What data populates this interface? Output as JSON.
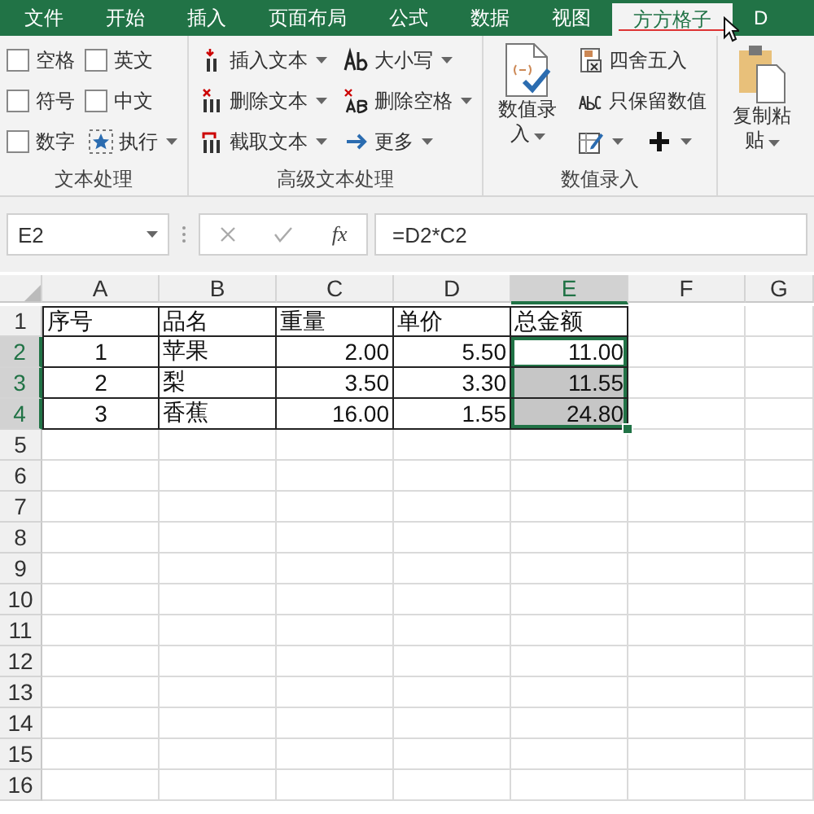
{
  "tabs": [
    {
      "label": "文件",
      "selected": false
    },
    {
      "label": "开始",
      "selected": false
    },
    {
      "label": "插入",
      "selected": false
    },
    {
      "label": "页面布局",
      "selected": false
    },
    {
      "label": "公式",
      "selected": false
    },
    {
      "label": "数据",
      "selected": false
    },
    {
      "label": "视图",
      "selected": false
    },
    {
      "label": "方方格子",
      "selected": true
    },
    {
      "label": "D",
      "selected": false
    }
  ],
  "ribbon": {
    "groups": [
      {
        "label": "文本处理",
        "items": [
          {
            "kind": "checkbox",
            "label": "空格",
            "checked": false
          },
          {
            "kind": "checkbox",
            "label": "符号",
            "checked": false
          },
          {
            "kind": "checkbox",
            "label": "数字",
            "checked": false
          },
          {
            "kind": "checkbox",
            "label": "英文",
            "checked": false
          },
          {
            "kind": "checkbox",
            "label": "中文",
            "checked": false
          },
          {
            "kind": "small",
            "label": "执行",
            "dropdown": true
          }
        ]
      },
      {
        "label": "高级文本处理",
        "items": [
          {
            "kind": "small",
            "label": "插入文本",
            "dropdown": true
          },
          {
            "kind": "small",
            "label": "删除文本",
            "dropdown": true
          },
          {
            "kind": "small",
            "label": "截取文本",
            "dropdown": true
          },
          {
            "kind": "small",
            "label": "大小写",
            "dropdown": true
          },
          {
            "kind": "small",
            "label": "删除空格",
            "dropdown": true
          },
          {
            "kind": "small",
            "label": "更多",
            "dropdown": true
          }
        ]
      },
      {
        "label": "数值录入",
        "items": [
          {
            "kind": "large",
            "label": "数值录入",
            "dropdown": true
          },
          {
            "kind": "small",
            "label": "四舍五入",
            "dropdown": false
          },
          {
            "kind": "small",
            "label": "只保留数值",
            "dropdown": false
          },
          {
            "kind": "icon",
            "dropdown": true
          },
          {
            "kind": "icon",
            "dropdown": true
          }
        ]
      },
      {
        "items": [
          {
            "kind": "large",
            "label": "复制粘贴",
            "dropdown": true
          }
        ]
      }
    ]
  },
  "formula_bar": {
    "name_box": "E2",
    "function_label": "fx",
    "formula": "=D2*C2"
  },
  "sheet": {
    "columns": [
      {
        "label": "A",
        "selected": false
      },
      {
        "label": "B",
        "selected": false
      },
      {
        "label": "C",
        "selected": false
      },
      {
        "label": "D",
        "selected": false
      },
      {
        "label": "E",
        "selected": true
      },
      {
        "label": "F",
        "selected": false
      },
      {
        "label": "G",
        "selected": false
      }
    ],
    "rows": [
      {
        "header": "1",
        "selected": false,
        "cells": [
          {
            "text": "序号",
            "kind": "text",
            "selected": false,
            "active": false
          },
          {
            "text": "品名",
            "kind": "text",
            "selected": false,
            "active": false
          },
          {
            "text": "重量",
            "kind": "text",
            "selected": false,
            "active": false
          },
          {
            "text": "单价",
            "kind": "text",
            "selected": false,
            "active": false
          },
          {
            "text": "总金额",
            "kind": "text",
            "selected": false,
            "active": false
          }
        ]
      },
      {
        "header": "2",
        "selected": true,
        "cells": [
          {
            "text": "1",
            "kind": "center",
            "selected": false,
            "active": false
          },
          {
            "text": "苹果",
            "kind": "text",
            "selected": false,
            "active": false
          },
          {
            "text": "2.00",
            "kind": "number",
            "selected": false,
            "active": false
          },
          {
            "text": "5.50",
            "kind": "number",
            "selected": false,
            "active": false
          },
          {
            "text": "11.00",
            "kind": "number",
            "selected": true,
            "active": true
          }
        ]
      },
      {
        "header": "3",
        "selected": true,
        "cells": [
          {
            "text": "2",
            "kind": "center",
            "selected": false,
            "active": false
          },
          {
            "text": "梨",
            "kind": "text",
            "selected": false,
            "active": false
          },
          {
            "text": "3.50",
            "kind": "number",
            "selected": false,
            "active": false
          },
          {
            "text": "3.30",
            "kind": "number",
            "selected": false,
            "active": false
          },
          {
            "text": "11.55",
            "kind": "number",
            "selected": true,
            "active": false
          }
        ]
      },
      {
        "header": "4",
        "selected": true,
        "cells": [
          {
            "text": "3",
            "kind": "center",
            "selected": false,
            "active": false
          },
          {
            "text": "香蕉",
            "kind": "text",
            "selected": false,
            "active": false
          },
          {
            "text": "16.00",
            "kind": "number",
            "selected": false,
            "active": false
          },
          {
            "text": "1.55",
            "kind": "number",
            "selected": false,
            "active": false
          },
          {
            "text": "24.80",
            "kind": "number",
            "selected": true,
            "active": false
          }
        ]
      },
      {
        "header": "5",
        "selected": false
      },
      {
        "header": "6",
        "selected": false
      },
      {
        "header": "7",
        "selected": false
      },
      {
        "header": "8",
        "selected": false
      },
      {
        "header": "9",
        "selected": false
      },
      {
        "header": "10",
        "selected": false
      },
      {
        "header": "11",
        "selected": false
      },
      {
        "header": "12",
        "selected": false
      },
      {
        "header": "13",
        "selected": false
      },
      {
        "header": "14",
        "selected": false
      },
      {
        "header": "15",
        "selected": false
      },
      {
        "header": "16",
        "selected": false
      }
    ]
  }
}
